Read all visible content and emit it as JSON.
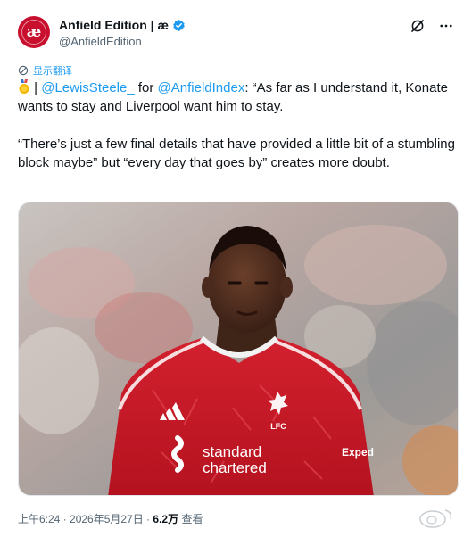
{
  "account": {
    "avatar_text": "æ",
    "display_name": "Anfield Edition | æ",
    "handle": "@AnfieldEdition"
  },
  "translate_label": "显示翻译",
  "tweet": {
    "prefix": " | ",
    "mention1": "@LewisSteele_",
    "for_text": " for ",
    "mention2": "@AnfieldIndex",
    "line1_rest": ": “As far as I understand it, Konate wants to stay and Liverpool want him to stay.",
    "paragraph2": "“There’s just a few final details that have provided a little bit of a stumbling block maybe” but “every day that goes by” creates more doubt."
  },
  "media": {
    "shirt_sponsor_line1": "standard",
    "shirt_sponsor_line2": "chartered",
    "sleeve_text": "Exped",
    "crest_text": "LFC"
  },
  "meta": {
    "time": "上午6:24",
    "separator": " · ",
    "date": "2026年5月27日",
    "views_count": "6.2万",
    "views_label": " 查看"
  },
  "colors": {
    "accent": "#1d9bf0",
    "shirt_red": "#c8102e",
    "text": "#0f1419",
    "secondary_text": "#536471"
  }
}
